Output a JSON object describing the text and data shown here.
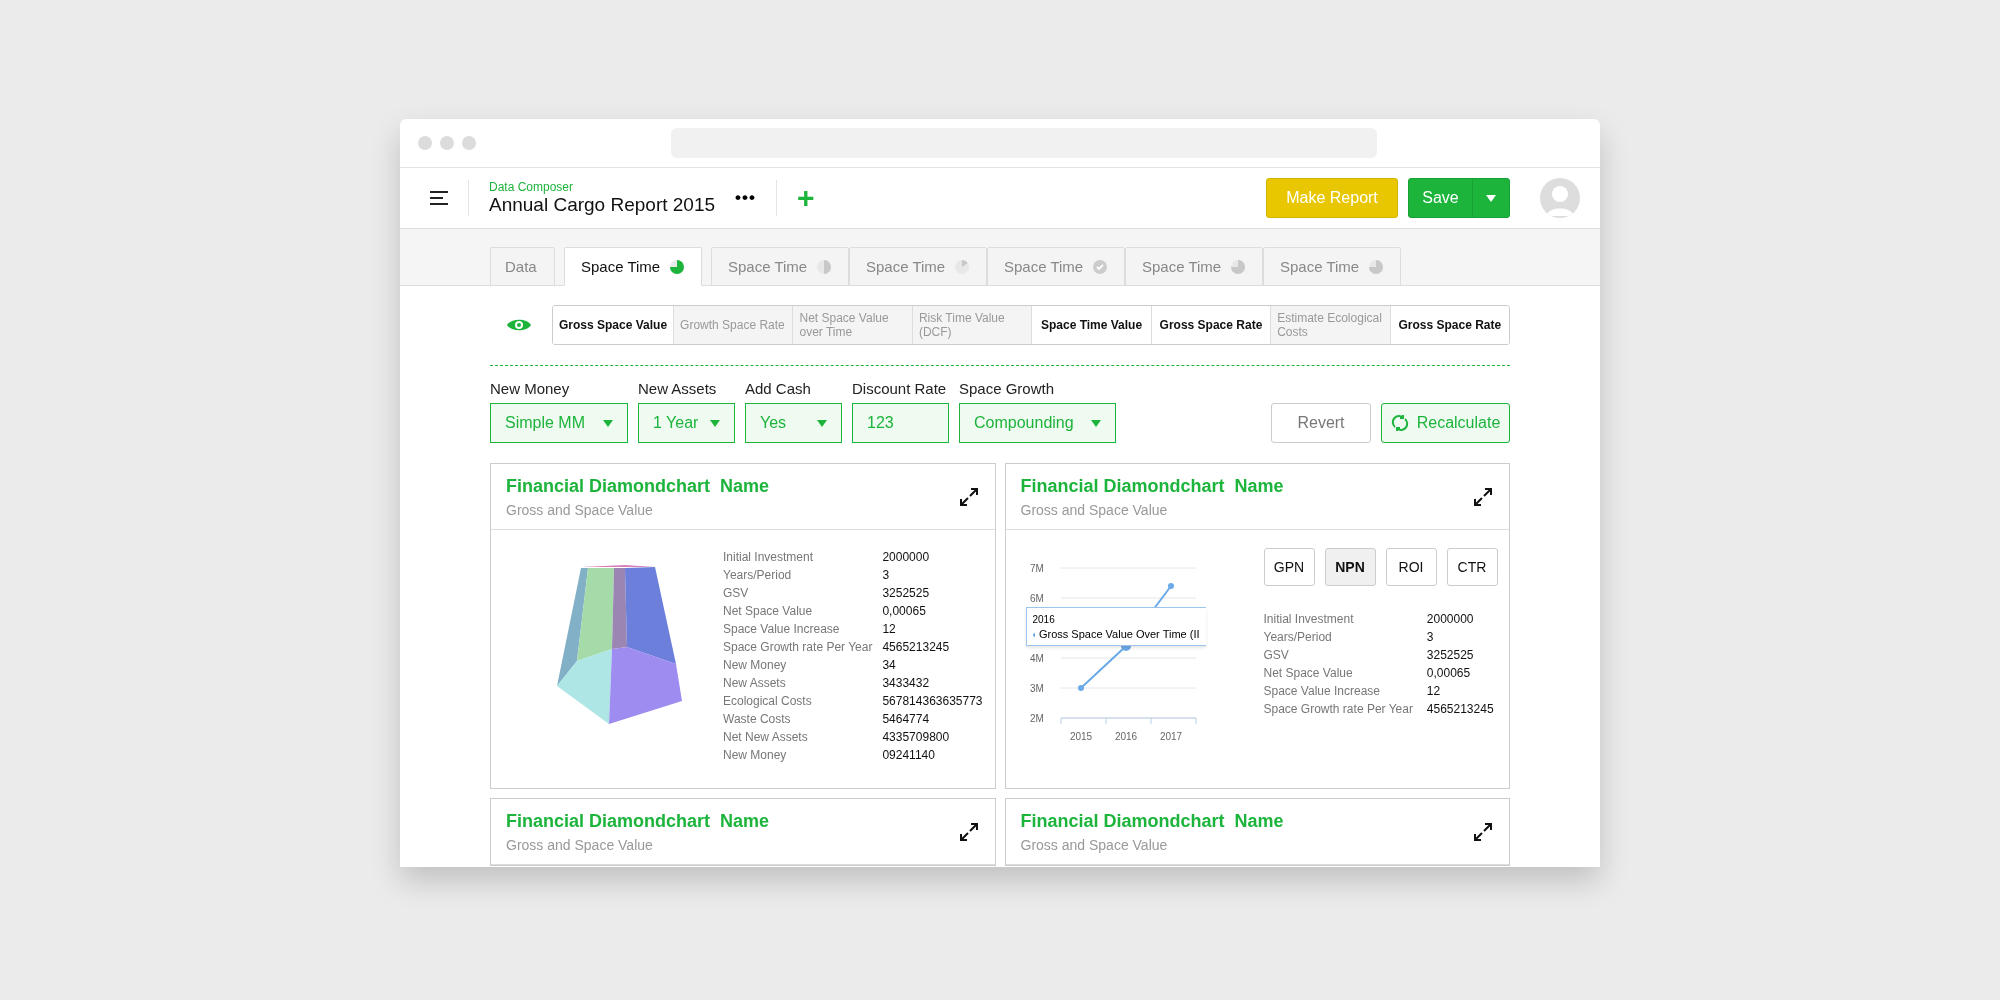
{
  "header": {
    "app_name": "Data Composer",
    "title": "Annual Cargo Report 2015",
    "more": "•••",
    "add": "+",
    "make_report": "Make Report",
    "save": "Save"
  },
  "tabs": [
    {
      "label": "Data",
      "selected": false
    },
    {
      "label": "Space Time",
      "selected": true,
      "kind": "threequarter"
    },
    {
      "label": "Space Time",
      "selected": false,
      "kind": "half"
    },
    {
      "label": "Space Time",
      "selected": false,
      "kind": "eighth"
    },
    {
      "label": "Space Time",
      "selected": false,
      "kind": "check"
    },
    {
      "label": "Space Time",
      "selected": false,
      "kind": "threequarter"
    },
    {
      "label": "Space Time",
      "selected": false,
      "kind": "threequarter"
    }
  ],
  "segments": [
    {
      "label": "Gross Space Value",
      "selected": true
    },
    {
      "label": "Growth Space Rate",
      "selected": false
    },
    {
      "label": "Net Space Value over Time",
      "selected": false
    },
    {
      "label": "Risk Time Value (DCF)",
      "selected": false
    },
    {
      "label": "Space Time Value",
      "selected": true
    },
    {
      "label": "Gross Space Rate",
      "selected": true
    },
    {
      "label": "Estimate Ecological Costs",
      "selected": false
    },
    {
      "label": "Gross Space Rate",
      "selected": true
    }
  ],
  "fields": [
    {
      "label": "New Money",
      "value": "Simple MM",
      "kind": "select"
    },
    {
      "label": "New Assets",
      "value": "1 Year",
      "kind": "select"
    },
    {
      "label": "Add Cash",
      "value": "Yes",
      "kind": "select"
    },
    {
      "label": "Discount Rate",
      "value": "123",
      "kind": "input"
    },
    {
      "label": "Space Growth",
      "value": "Compounding",
      "kind": "select"
    }
  ],
  "revert": "Revert",
  "recalculate": "Recalculate",
  "cards": [
    {
      "title": "Financial Diamondchart  Name",
      "subtitle": "Gross and Space Value",
      "kind": "pyramid",
      "stats": [
        {
          "label": "Initial Investment",
          "value": "2000000"
        },
        {
          "label": "Years/Period",
          "value": "3"
        },
        {
          "label": "GSV",
          "value": "3252525"
        },
        {
          "label": "Net Space Value",
          "value": "0,00065"
        },
        {
          "label": "Space Value Increase",
          "value": "12"
        },
        {
          "label": "Space Growth rate Per Year",
          "value": "4565213245"
        },
        {
          "label": "New Money",
          "value": "34"
        },
        {
          "label": "New Assets",
          "value": "3433432"
        },
        {
          "label": "Ecological Costs",
          "value": "567814363635773"
        },
        {
          "label": "Waste Costs",
          "value": "5464774"
        },
        {
          "label": "Net New Assets",
          "value": "4335709800"
        },
        {
          "label": "New Money",
          "value": "09241140"
        }
      ]
    },
    {
      "title": "Financial Diamondchart  Name",
      "subtitle": "Gross and Space Value",
      "kind": "line",
      "chart_data": {
        "type": "line",
        "grid": true,
        "categories": [
          "2015",
          "2016",
          "2017"
        ],
        "series": [
          {
            "name": "Gross Space Value Over Time (II",
            "color": "#6aaae8",
            "marker": "circle",
            "values": [
              3000000,
              4400000,
              6400000
            ]
          }
        ],
        "ylim": [
          2000000,
          7000000
        ],
        "yticks": [
          {
            "value": 2000000,
            "label": "2M"
          },
          {
            "value": 3000000,
            "label": "3M"
          },
          {
            "value": 4000000,
            "label": "4M"
          },
          {
            "value": 6000000,
            "label": "6M"
          },
          {
            "value": 7000000,
            "label": "7M"
          }
        ]
      },
      "tooltip": {
        "title": "2016"
      },
      "buttons": [
        {
          "label": "GPN",
          "selected": false
        },
        {
          "label": "NPN",
          "selected": true
        },
        {
          "label": "ROI",
          "selected": false
        },
        {
          "label": "CTR",
          "selected": false
        }
      ],
      "stats": [
        {
          "label": "Initial Investment",
          "value": "2000000"
        },
        {
          "label": "Years/Period",
          "value": "3"
        },
        {
          "label": "GSV",
          "value": "3252525"
        },
        {
          "label": "Net Space Value",
          "value": "0,00065"
        },
        {
          "label": "Space Value Increase",
          "value": "12"
        },
        {
          "label": "Space Growth rate Per Year",
          "value": "4565213245"
        }
      ]
    },
    {
      "title": "Financial Diamondchart  Name",
      "subtitle": "Gross and Space Value",
      "kind": "collapsed"
    },
    {
      "title": "Financial Diamondchart  Name",
      "subtitle": "Gross and Space Value",
      "kind": "collapsed"
    }
  ]
}
